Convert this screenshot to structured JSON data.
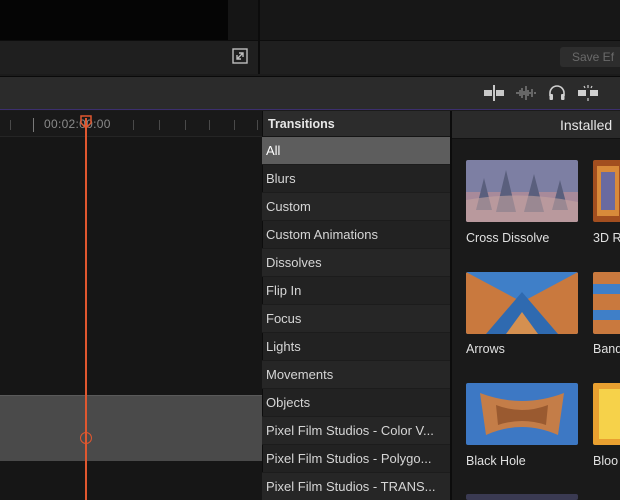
{
  "viewer": {
    "save_label": "Save Ef"
  },
  "timeline": {
    "timecode": "00:02:00:00"
  },
  "sidebar": {
    "title": "Transitions",
    "categories": [
      {
        "label": "All",
        "selected": true
      },
      {
        "label": "Blurs"
      },
      {
        "label": "Custom"
      },
      {
        "label": "Custom Animations"
      },
      {
        "label": "Dissolves"
      },
      {
        "label": "Flip In"
      },
      {
        "label": "Focus"
      },
      {
        "label": "Lights"
      },
      {
        "label": "Movements"
      },
      {
        "label": "Objects"
      },
      {
        "label": "Pixel Film Studios - Color V..."
      },
      {
        "label": "Pixel Film Studios - Polygo..."
      },
      {
        "label": "Pixel Film Studios - TRANS..."
      }
    ]
  },
  "installed": {
    "title": "Installed",
    "items": [
      {
        "label": "Cross Dissolve"
      },
      {
        "label": "3D R"
      },
      {
        "label": "Arrows"
      },
      {
        "label": "Band"
      },
      {
        "label": "Black Hole"
      },
      {
        "label": "Bloo"
      }
    ]
  },
  "colors": {
    "accent": "#e0572f",
    "selection": "#5d5d5d"
  }
}
